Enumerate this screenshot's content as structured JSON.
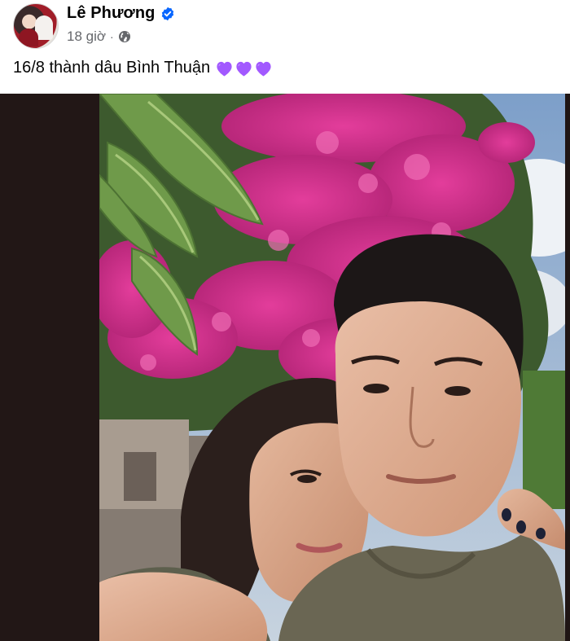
{
  "post": {
    "author_name": "Lê Phương",
    "timestamp": "18 giờ",
    "separator": "·",
    "privacy_icon": "globe-icon",
    "verified_icon": "verified-badge-icon",
    "caption_text": "16/8 thành dâu Bình Thuận",
    "caption_emojis": [
      "purple-heart",
      "purple-heart",
      "purple-heart"
    ]
  },
  "colors": {
    "verified_badge": "#0866ff",
    "secondary_text": "#65676b",
    "heart": "#a259ff"
  }
}
